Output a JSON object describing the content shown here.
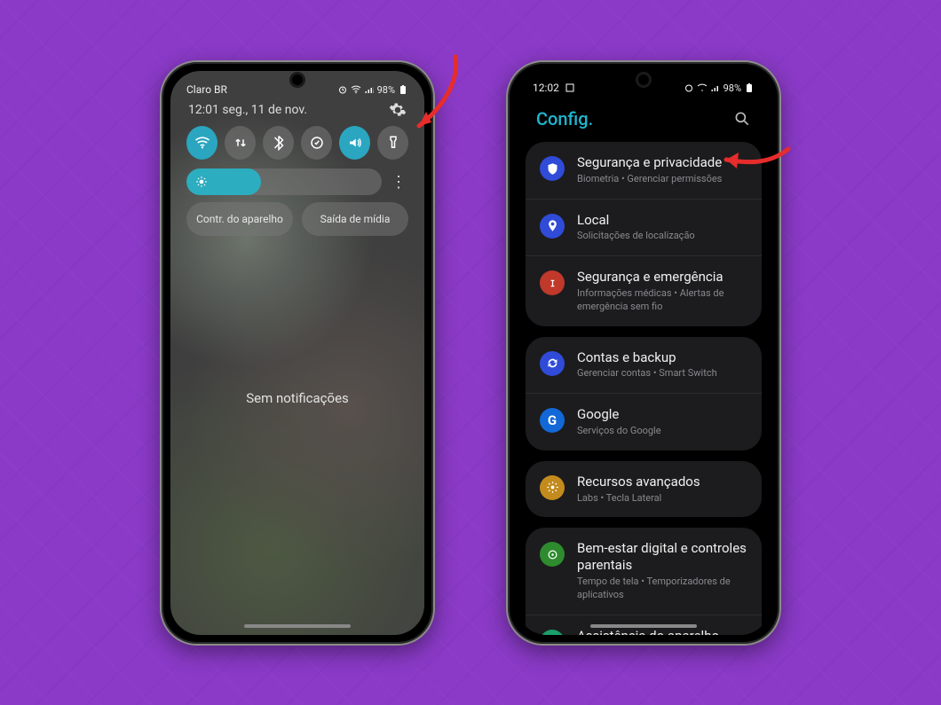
{
  "phone_left": {
    "carrier": "Claro BR",
    "status_right": "98%",
    "datetime": "12:01 seg., 11 de nov.",
    "tiles": [
      {
        "name": "wifi",
        "active": true
      },
      {
        "name": "data-swap",
        "active": false
      },
      {
        "name": "bluetooth",
        "active": false
      },
      {
        "name": "power-save",
        "active": false
      },
      {
        "name": "sound",
        "active": true
      },
      {
        "name": "flashlight",
        "active": false
      }
    ],
    "brightness_percent": 38,
    "link_device_controls": "Contr. do aparelho",
    "link_media_output": "Saída de mídia",
    "no_notifications": "Sem notificações"
  },
  "phone_right": {
    "time": "12:02",
    "status_right": "98%",
    "title": "Config.",
    "groups": [
      [
        {
          "icon": "shield",
          "color": "c-shield",
          "title": "Segurança e privacidade",
          "sub": "Biometria  •  Gerenciar permissões"
        },
        {
          "icon": "pin",
          "color": "c-loc",
          "title": "Local",
          "sub": "Solicitações de localização"
        },
        {
          "icon": "sos",
          "color": "c-emerg",
          "title": "Segurança e emergência",
          "sub": "Informações médicas  •  Alertas de emergência sem fio"
        }
      ],
      [
        {
          "icon": "sync",
          "color": "c-sync",
          "title": "Contas e backup",
          "sub": "Gerenciar contas  •  Smart Switch"
        },
        {
          "icon": "google",
          "color": "c-google",
          "title": "Google",
          "sub": "Serviços do Google"
        }
      ],
      [
        {
          "icon": "adv",
          "color": "c-adv",
          "title": "Recursos avançados",
          "sub": "Labs  •  Tecla Lateral"
        }
      ],
      [
        {
          "icon": "well",
          "color": "c-well",
          "title": "Bem-estar digital e controles parentais",
          "sub": "Tempo de tela  •  Temporizadores de aplicativos"
        },
        {
          "icon": "assist",
          "color": "c-assist",
          "title": "Assistência do aparelho",
          "sub": ""
        }
      ]
    ]
  },
  "annotations": {
    "arrow_left_target": "settings-gear",
    "arrow_right_target": "security-privacy-item"
  }
}
